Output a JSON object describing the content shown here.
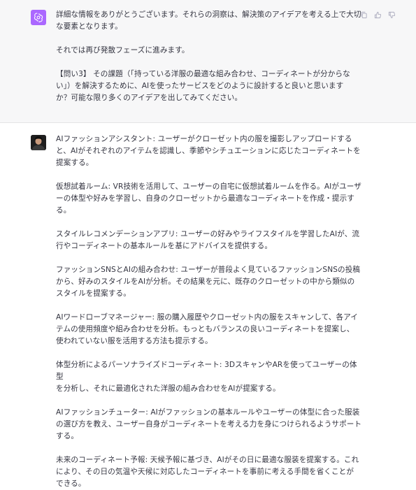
{
  "assistant_message": {
    "avatar_icon": "openai-logo-icon",
    "avatar_color": "#ab68ff",
    "paragraphs": [
      "詳細な情報をありがとうございます。それらの洞察は、解決策のアイデアを考える上で大切\nな要素となります。",
      "それでは再び発散フェーズに進みます。",
      "【問い3】 その課題（「持っている洋服の最適な組み合わせ、コーディネートが分からな\nい」）を解決するために、AIを使ったサービスをどのように設計すると良いと思います\nか？可能な限り多くのアイデアを出してみてください。"
    ],
    "actions": [
      "copy-icon",
      "thumbs-up-icon",
      "thumbs-down-icon"
    ]
  },
  "user_message": {
    "avatar_icon": "user-avatar",
    "paragraphs": [
      "AIファッションアシスタント: ユーザーがクローゼット内の服を撮影しアップロードする\nと、AIがそれぞれのアイテムを認識し、季節やシチュエーションに応じたコーディネートを\n提案する。",
      "仮想試着ルーム: VR技術を活用して、ユーザーの自宅に仮想試着ルームを作る。AIがユーザ\nーの体型や好みを学習し、自身のクローゼットから最適なコーディネートを作成・提示す\nる。",
      "スタイルレコメンデーションアプリ: ユーザーの好みやライフスタイルを学習したAIが、流\n行やコーディネートの基本ルールを基にアドバイスを提供する。",
      "ファッションSNSとAIの組み合わせ: ユーザーが普段よく見ているファッションSNSの投稿\nから、好みのスタイルをAIが分析。その結果を元に、既存のクローゼットの中から類似の\nスタイルを提案する。",
      "AIワードローブマネージャー: 服の購入履歴やクローゼット内の服をスキャンして、各アイ\nテムの使用頻度や組み合わせを分析。もっともバランスの良いコーディネートを提案し、\n使われていない服を活用する方法も提示する。",
      "体型分析によるパーソナライズドコーディネート: 3DスキャンやARを使ってユーザーの体型\nを分析し、それに最適化された洋服の組み合わせをAIが提案する。",
      "AIファッションチューター: AIがファッションの基本ルールやユーザーの体型に合った服装\nの選び方を教え、ユーザー自身がコーディネートを考える力を身につけられるようサポート\nする。",
      "未来のコーディネート予報: 天候予報に基づき、AIがその日に最適な服装を提案する。これ\nにより、その日の気温や天候に対応したコーディネートを事前に考える手間を省くことが\nできる。"
    ]
  }
}
